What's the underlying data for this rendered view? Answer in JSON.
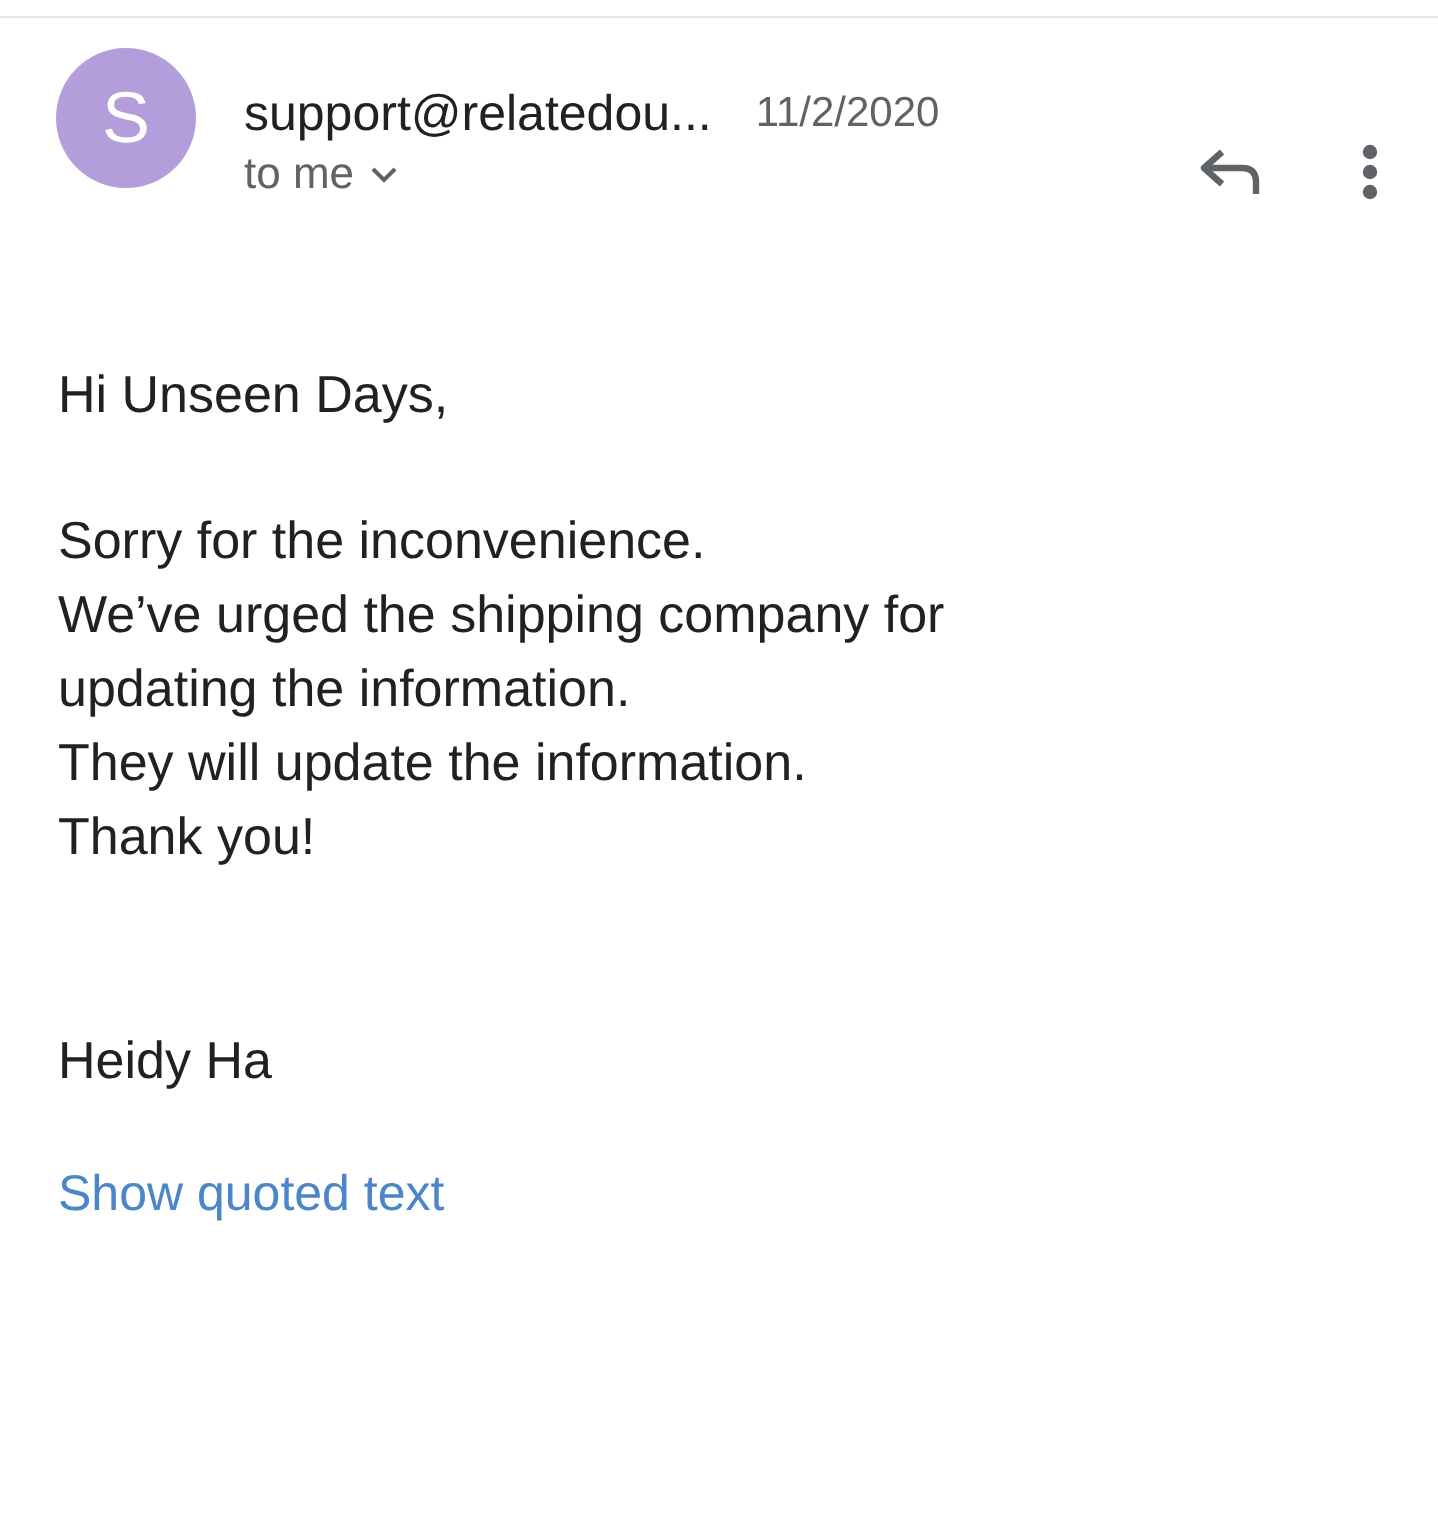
{
  "message": {
    "avatar_letter": "S",
    "sender": "support@relatedou...",
    "date": "11/2/2020",
    "recipient": "to me"
  },
  "body": [
    {
      "kind": "text",
      "lines": [
        "Hi Unseen Days,"
      ]
    },
    {
      "kind": "text",
      "lines": [
        "Sorry for the inconvenience.",
        "We’ve urged the shipping company for",
        "updating the information.",
        "They will update the information.",
        "Thank you!"
      ]
    },
    {
      "kind": "signature",
      "lines": [
        "Heidy Ha"
      ]
    }
  ],
  "show_quoted_link": "Show quoted text"
}
